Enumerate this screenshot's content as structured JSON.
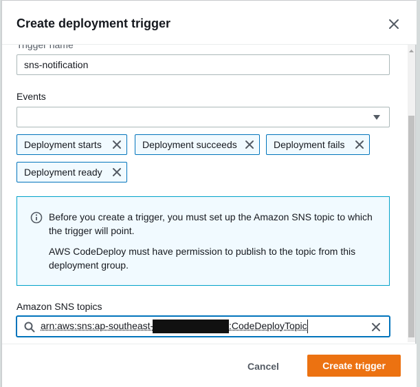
{
  "modal": {
    "title": "Create deployment trigger"
  },
  "trigger_name": {
    "label": "Trigger name",
    "value": "sns-notification"
  },
  "events": {
    "label": "Events",
    "selected": [
      "Deployment starts",
      "Deployment succeeds",
      "Deployment fails",
      "Deployment ready"
    ]
  },
  "info_alert": {
    "line1": "Before you create a trigger, you must set up the Amazon SNS topic to which the trigger will point.",
    "line2": "AWS CodeDeploy must have permission to publish to the topic from this deployment group."
  },
  "sns_topics": {
    "label": "Amazon SNS topics",
    "value_prefix": "arn:aws:sns:ap-southeast-",
    "value_suffix": ":CodeDeployTopic"
  },
  "footer": {
    "cancel_label": "Cancel",
    "create_label": "Create trigger"
  },
  "colors": {
    "primary_button": "#ec7211",
    "token_border": "#0073bb",
    "info_border": "#00a1c9",
    "info_background": "#f1faff"
  },
  "icons": {
    "close": "close-icon",
    "remove_token": "x-icon",
    "info": "info-icon",
    "search": "search-icon",
    "clear": "clear-icon",
    "dropdown": "caret-down-icon"
  }
}
